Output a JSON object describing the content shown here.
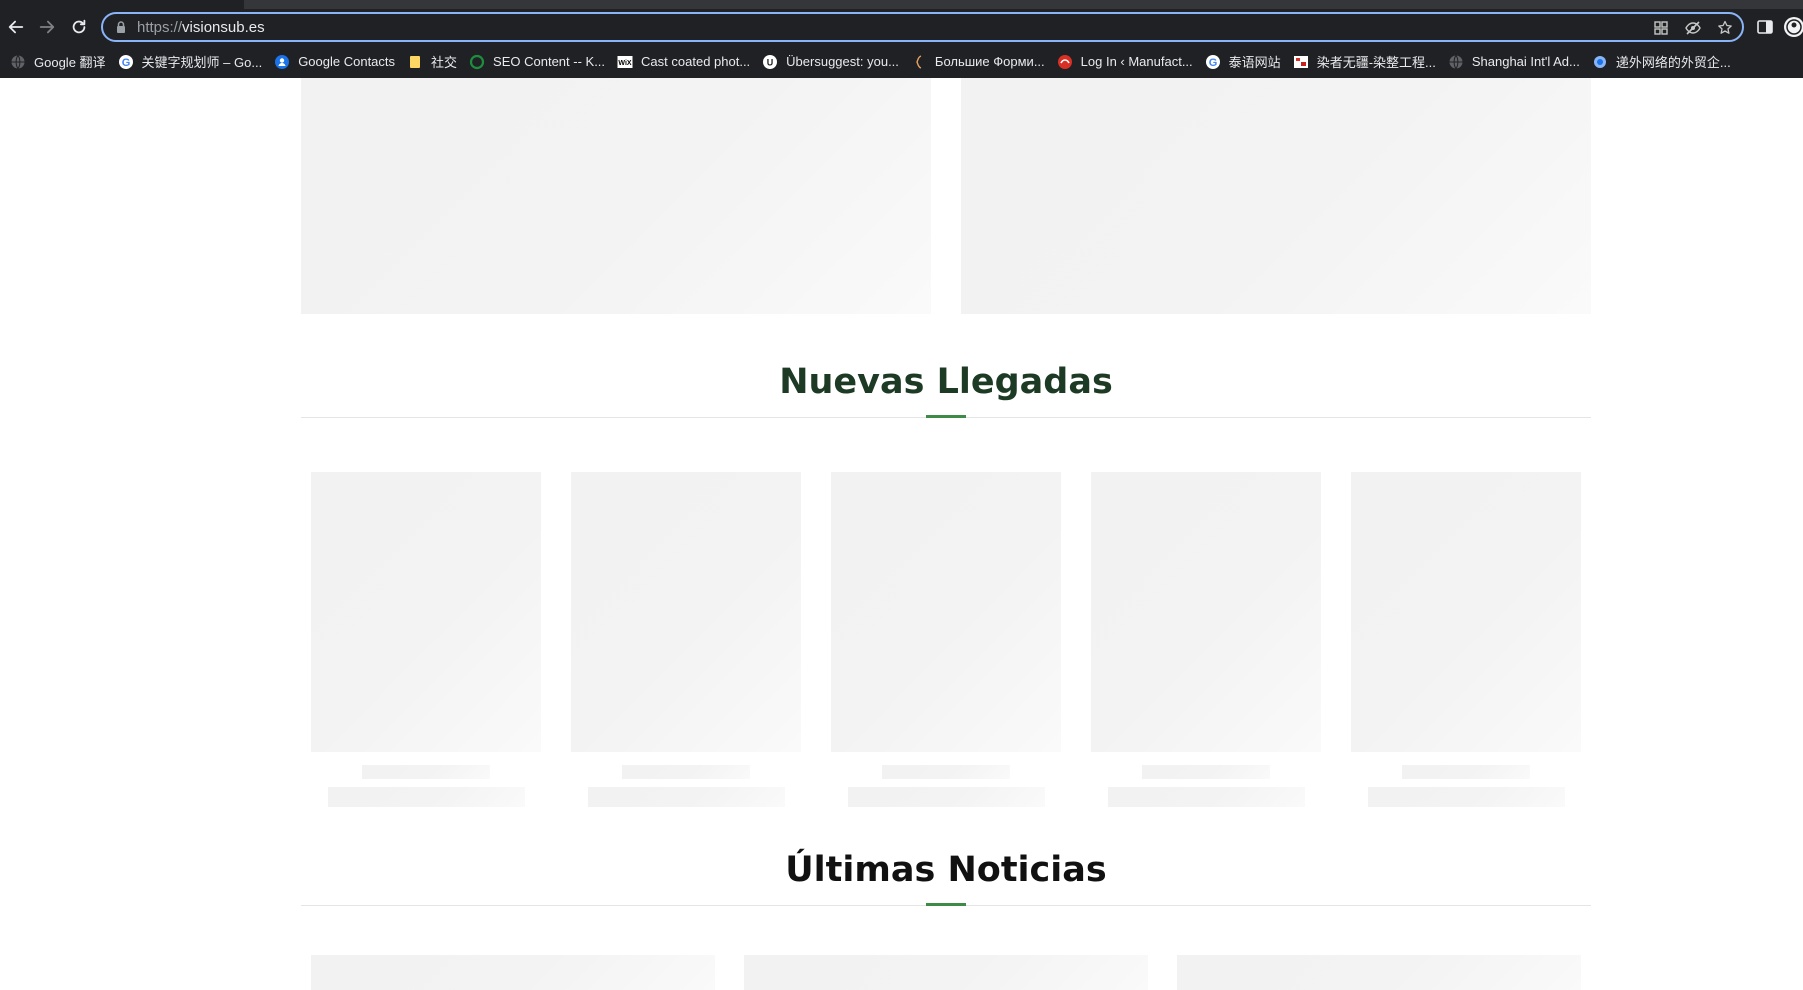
{
  "browser": {
    "url_scheme": "https://",
    "url_host": "visionsub.es",
    "bookmarks": [
      {
        "label": "Google 翻译",
        "icon": "globe-icon"
      },
      {
        "label": "关键字规划师 – Go...",
        "icon": "google-icon"
      },
      {
        "label": "Google Contacts",
        "icon": "contacts-icon"
      },
      {
        "label": "社交",
        "icon": "folder-icon"
      },
      {
        "label": "SEO Content -- K...",
        "icon": "ring-icon"
      },
      {
        "label": "Cast coated phot...",
        "icon": "wix-icon"
      },
      {
        "label": "Übersuggest: you...",
        "icon": "ubersuggest-icon"
      },
      {
        "label": "Большие Форми...",
        "icon": "bracket-icon"
      },
      {
        "label": "Log In ‹ Manufact...",
        "icon": "manufact-icon"
      },
      {
        "label": "泰语网站",
        "icon": "google-icon"
      },
      {
        "label": "染者无疆-染整工程...",
        "icon": "image-icon"
      },
      {
        "label": "Shanghai Int'l Ad...",
        "icon": "globe-icon"
      },
      {
        "label": "递外网络的外贸企...",
        "icon": "shield-globe-icon"
      }
    ]
  },
  "page": {
    "sections": {
      "new_arrivals": {
        "title": "Nuevas Llegadas",
        "color": "#1d3a24"
      },
      "latest_news": {
        "title": "Últimas Noticias",
        "color": "#111111"
      }
    },
    "product_placeholders": 5,
    "news_placeholders": 3,
    "accent_color": "#3d8b47"
  }
}
